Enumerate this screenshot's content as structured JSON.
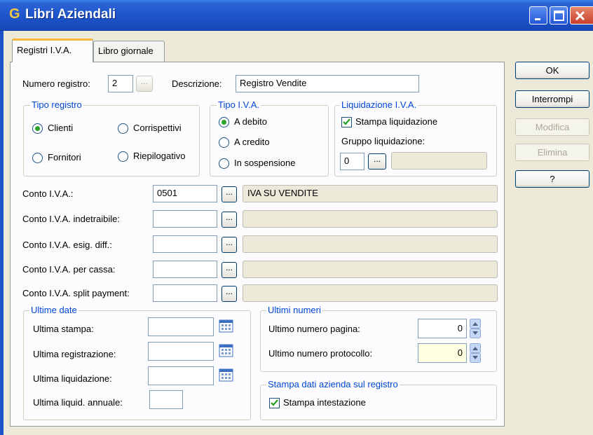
{
  "window": {
    "logo": "G",
    "title": "Libri Aziendali"
  },
  "tabs": [
    "Registri I.V.A.",
    "Libro giornale"
  ],
  "buttons": {
    "ok": "OK",
    "cancel": "Interrompi",
    "edit": "Modifica",
    "delete": "Elimina",
    "help": "?"
  },
  "registro": {
    "numero_label": "Numero registro:",
    "numero_value": "2",
    "descrizione_label": "Descrizione:",
    "descrizione_value": "Registro Vendite"
  },
  "tipo_registro": {
    "legend": "Tipo registro",
    "options": [
      "Clienti",
      "Corrispettivi",
      "Fornitori",
      "Riepilogativo"
    ],
    "selected": "Clienti"
  },
  "tipo_iva": {
    "legend": "Tipo I.V.A.",
    "options": [
      "A debito",
      "A credito",
      "In sospensione"
    ],
    "selected": "A debito"
  },
  "liquidazione": {
    "legend": "Liquidazione I.V.A.",
    "stampa_label": "Stampa liquidazione",
    "stampa_checked": true,
    "gruppo_label": "Gruppo liquidazione:",
    "gruppo_value": "0"
  },
  "conti": [
    {
      "label": "Conto I.V.A.:",
      "code": "0501",
      "desc": "IVA SU VENDITE"
    },
    {
      "label": "Conto I.V.A. indetraibile:",
      "code": "",
      "desc": ""
    },
    {
      "label": "Conto I.V.A. esig. diff.:",
      "code": "",
      "desc": ""
    },
    {
      "label": "Conto I.V.A. per cassa:",
      "code": "",
      "desc": ""
    },
    {
      "label": "Conto I.V.A. split payment:",
      "code": "",
      "desc": ""
    }
  ],
  "ultime_date": {
    "legend": "Ultime date",
    "rows": [
      {
        "label": "Ultima stampa:",
        "value": ""
      },
      {
        "label": "Ultima registrazione:",
        "value": ""
      },
      {
        "label": "Ultima liquidazione:",
        "value": ""
      },
      {
        "label": "Ultima liquid. annuale:",
        "value": ""
      }
    ]
  },
  "ultimi_numeri": {
    "legend": "Ultimi numeri",
    "pagina_label": "Ultimo numero pagina:",
    "pagina_value": "0",
    "protocollo_label": "Ultimo numero protocollo:",
    "protocollo_value": "0"
  },
  "stampa_dati": {
    "legend": "Stampa dati azienda sul registro",
    "label": "Stampa intestazione",
    "checked": true
  },
  "dots_label": "...",
  "colors": {
    "titlebar": "#1c52c8",
    "legend": "#0046d5",
    "face": "#ece9d8",
    "highlight_input": "#ffffe1"
  }
}
